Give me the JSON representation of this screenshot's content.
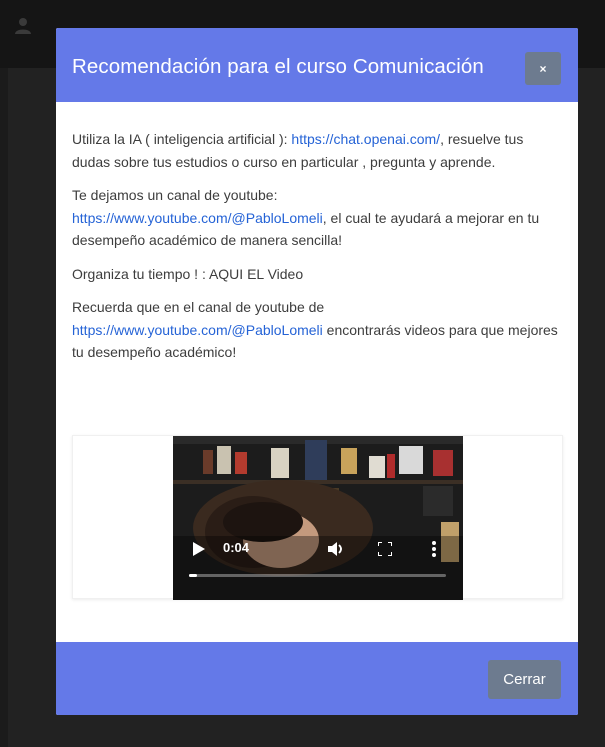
{
  "modal": {
    "title": "Recomendación para el curso Comunicación",
    "close_label": "×",
    "paragraphs": {
      "p1_pre": "Utiliza la IA ( inteligencia artificial ): ",
      "p1_link": "https://chat.openai.com/",
      "p1_post": ", resuelve tus dudas sobre tus estudios o curso en particular , pregunta y aprende.",
      "p2_pre": "Te dejamos un canal de youtube: ",
      "p2_link": "https://www.youtube.com/@PabloLomeli",
      "p2_post": ", el cual te ayudará a mejorar en tu desempeño académico de manera sencilla!",
      "p3": "Organiza tu tiempo ! : AQUI EL Video",
      "p4_pre": "Recuerda que en el canal de youtube de ",
      "p4_link": "https://www.youtube.com/@PabloLomeli",
      "p4_post": " encontrarás videos para que mejores tu desempeño académico!"
    },
    "video": {
      "time": "0:04",
      "progress": 0.03
    },
    "footer": {
      "close_button": "Cerrar"
    }
  },
  "colors": {
    "header": "#6479e8",
    "button": "#6d7b8f",
    "link": "#2563d6"
  },
  "icons": [
    "user-icon",
    "play-icon",
    "volume-icon",
    "fullscreen-icon",
    "more-vertical-icon"
  ]
}
